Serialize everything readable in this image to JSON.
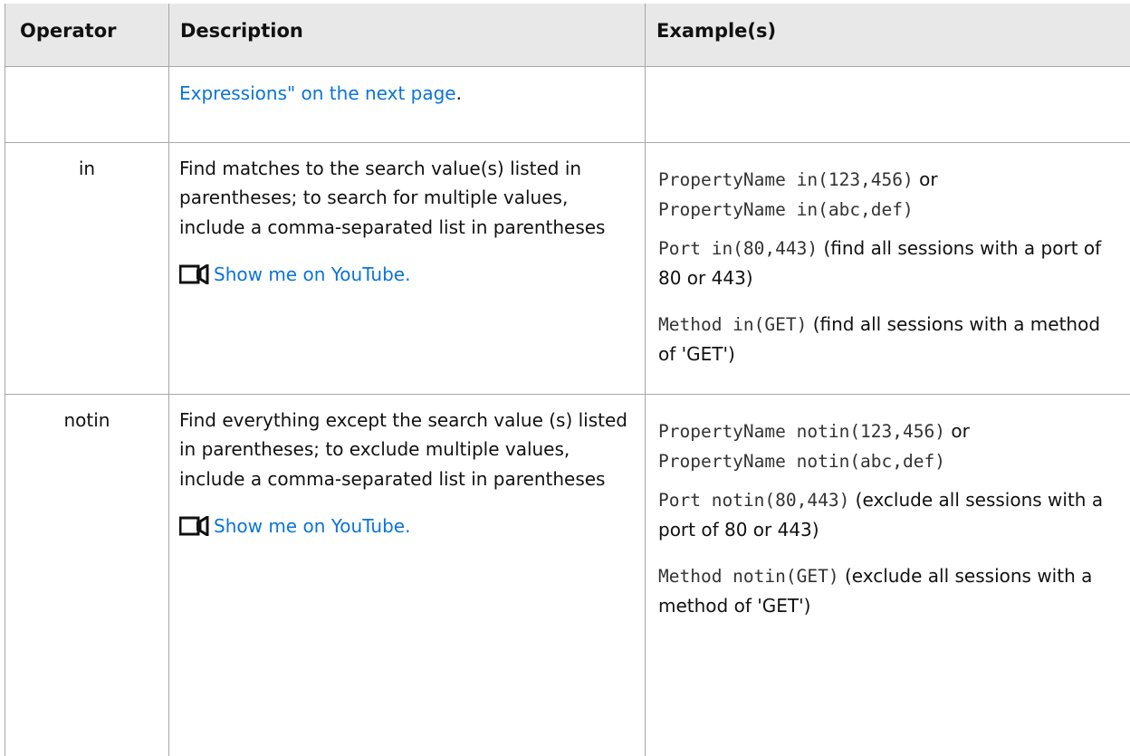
{
  "table": {
    "headers": {
      "operator": "Operator",
      "description": "Description",
      "examples": "Example(s)"
    },
    "continuation_row": {
      "description_link": "Expressions\" on the next page",
      "description_suffix": "."
    },
    "rows": [
      {
        "operator": "in",
        "description": "Find matches to the search value(s) listed in parentheses; to search for multiple values, include a comma-separated list in parentheses",
        "video_icon": "video-camera-icon",
        "video_link": "Show me on YouTube.",
        "examples": [
          {
            "code1": "PropertyName in(123,456)",
            "mid": " or ",
            "code2": "PropertyName in(abc,def)"
          },
          {
            "code": "Port in(80,443)",
            "text": " (find all sessions with a port of 80 or 443)"
          },
          {
            "code": "Method in(GET)",
            "text": " (find all sessions with a method of 'GET')"
          }
        ]
      },
      {
        "operator": "notin",
        "description": "Find everything except the search value (s) listed in parentheses; to exclude multiple values, include a comma-separated list in parentheses",
        "video_icon": "video-camera-icon",
        "video_link": "Show me on YouTube.",
        "examples": [
          {
            "code1": "PropertyName notin(123,456)",
            "mid": " or ",
            "code2": "PropertyName notin(abc,def)"
          },
          {
            "code": "Port notin(80,443)",
            "text": " (exclude all sessions with a port of 80 or 443)"
          },
          {
            "code": "Method notin(GET)",
            "text": " (exclude all sessions with a method of 'GET')"
          }
        ]
      }
    ]
  },
  "colors": {
    "header_bg": "#e8e8e8",
    "border": "#a7a7a7",
    "link": "#0a74db",
    "code": "#333333"
  }
}
